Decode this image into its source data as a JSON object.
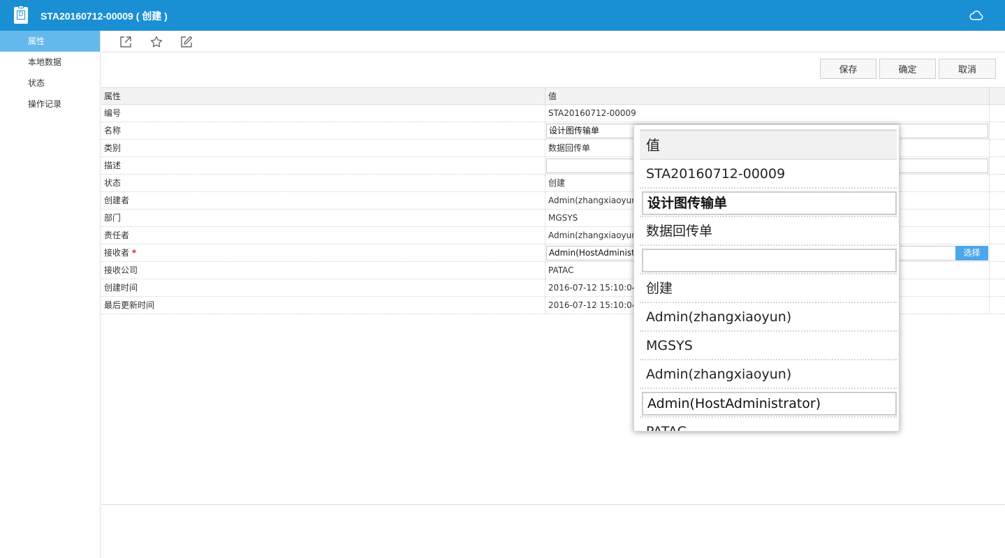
{
  "window": {
    "title": "STA20160712-00009 ( 创建 )",
    "doc_icon_letter": "D"
  },
  "sidebar": {
    "items": [
      {
        "label": "属性",
        "active": true
      },
      {
        "label": "本地数据",
        "active": false
      },
      {
        "label": "状态",
        "active": false
      },
      {
        "label": "操作记录",
        "active": false
      }
    ]
  },
  "toolbar": {
    "icons": [
      "open-external-icon",
      "star-icon",
      "edit-icon"
    ]
  },
  "actions": {
    "save": "保存",
    "confirm": "确定",
    "cancel": "取消"
  },
  "grid": {
    "headers": {
      "property": "属性",
      "value": "值"
    },
    "rows": [
      {
        "property": "编号",
        "value": "STA20160712-00009"
      },
      {
        "property": "名称",
        "value": "设计图传输单",
        "editable": true
      },
      {
        "property": "类别",
        "value": "数据回传单"
      },
      {
        "property": "描述",
        "value": "",
        "editable": true
      },
      {
        "property": "状态",
        "value": "创建"
      },
      {
        "property": "创建者",
        "value": "Admin(zhangxiaoyun)"
      },
      {
        "property": "部门",
        "value": "MGSYS"
      },
      {
        "property": "责任者",
        "value": "Admin(zhangxiaoyun)"
      },
      {
        "property": "接收者",
        "required_mark": "*",
        "value": "Admin(HostAdministrator)",
        "editable": true,
        "button": "选择"
      },
      {
        "property": "接收公司",
        "value": "PATAC"
      },
      {
        "property": "创建时间",
        "value": "2016-07-12 15:10:04"
      },
      {
        "property": "最后更新时间",
        "value": "2016-07-12 15:10:04"
      }
    ]
  },
  "zoom": {
    "header": "值",
    "rows": [
      "STA20160712-00009",
      "设计图传输单",
      "数据回传单",
      "",
      "创建",
      "Admin(zhangxiaoyun)",
      "MGSYS",
      "Admin(zhangxiaoyun)",
      "Admin(HostAdministrator)",
      "PATAC"
    ]
  },
  "colors": {
    "titlebar": "#1a8fd3",
    "sidebar_active": "#64b9ec",
    "select_button": "#4da7ea",
    "required": "#e02020"
  }
}
